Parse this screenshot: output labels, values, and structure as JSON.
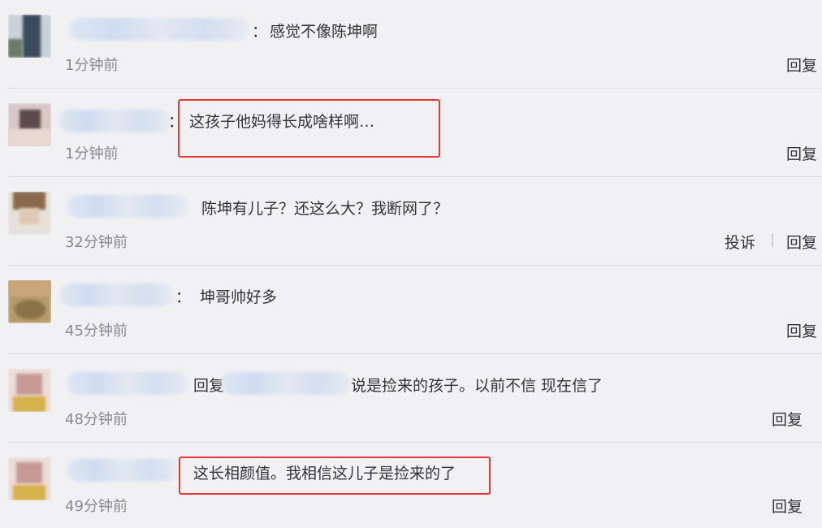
{
  "comments": [
    {
      "text": "感觉不像陈坤啊",
      "time": "1分钟前",
      "reply": "回复"
    },
    {
      "text": "这孩子他妈得长成啥样啊…",
      "time": "1分钟前",
      "reply": "回复"
    },
    {
      "text": "陈坤有儿子？还这么大？我断网了？",
      "time": "32分钟前",
      "report": "投诉",
      "separator": "|",
      "reply": "回复"
    },
    {
      "text": "坤哥帅好多",
      "time": "45分钟前",
      "reply": "回复"
    },
    {
      "reply_prefix": "回复",
      "text": "说是捡来的孩子。以前不信 现在信了",
      "time": "48分钟前",
      "reply": "回复"
    },
    {
      "text": "这长相颜值。我相信这儿子是捡来的了",
      "time": "49分钟前",
      "reply": "回复"
    }
  ],
  "colors": {
    "background": "#f1f1f3",
    "highlight_border": "#e53935",
    "time_text": "#8a8a8a"
  }
}
